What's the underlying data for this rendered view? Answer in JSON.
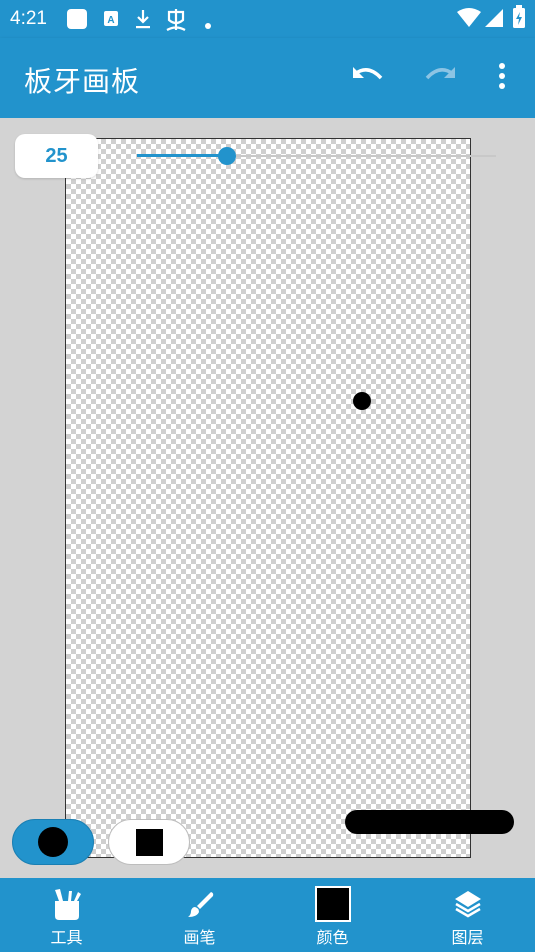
{
  "status_bar": {
    "time": "4:21"
  },
  "app_bar": {
    "title": "板牙画板"
  },
  "brush": {
    "size": "25",
    "size_fraction": 0.25,
    "shapes": [
      "circle",
      "square"
    ],
    "selected_shape": "circle"
  },
  "bottom_nav": {
    "tools": "工具",
    "brush": "画笔",
    "color": "颜色",
    "layers": "图层"
  },
  "colors": {
    "accent": "#2293cc",
    "brush_color": "#000000",
    "workspace": "#d3d3d3"
  },
  "icons": [
    "undo-icon",
    "redo-icon",
    "more-vert-icon",
    "tools-icon",
    "brush-icon",
    "layers-icon",
    "wifi-icon",
    "signal-icon",
    "battery-icon",
    "download-icon",
    "bug-icon"
  ]
}
